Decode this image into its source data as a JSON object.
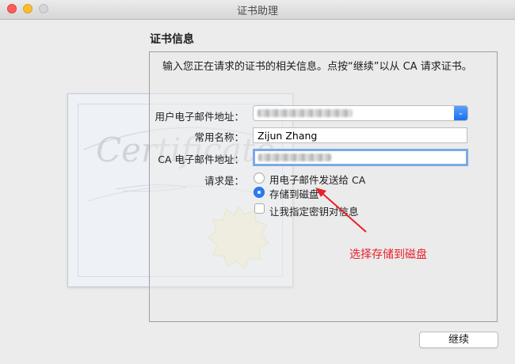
{
  "window": {
    "title": "证书助理"
  },
  "section": {
    "title": "证书信息"
  },
  "instruction": "输入您正在请求的证书的相关信息。点按“继续”以从 CA 请求证书。",
  "form": {
    "email_label": "用户电子邮件地址：",
    "name_label": "常用名称：",
    "name_value": "Zijun Zhang",
    "ca_email_label": "CA 电子邮件地址：",
    "request_label": "请求是：",
    "options": [
      {
        "label": "用电子邮件发送给 CA",
        "selected": false
      },
      {
        "label": "存储到磁盘",
        "selected": true
      }
    ],
    "key_pair_checkbox": {
      "label": "让我指定密钥对信息",
      "checked": false
    }
  },
  "annotation": {
    "text": "选择存储到磁盘",
    "color": "#e8202a"
  },
  "buttons": {
    "continue": "继续"
  },
  "certificate_art": {
    "script_text": "Certificate"
  }
}
